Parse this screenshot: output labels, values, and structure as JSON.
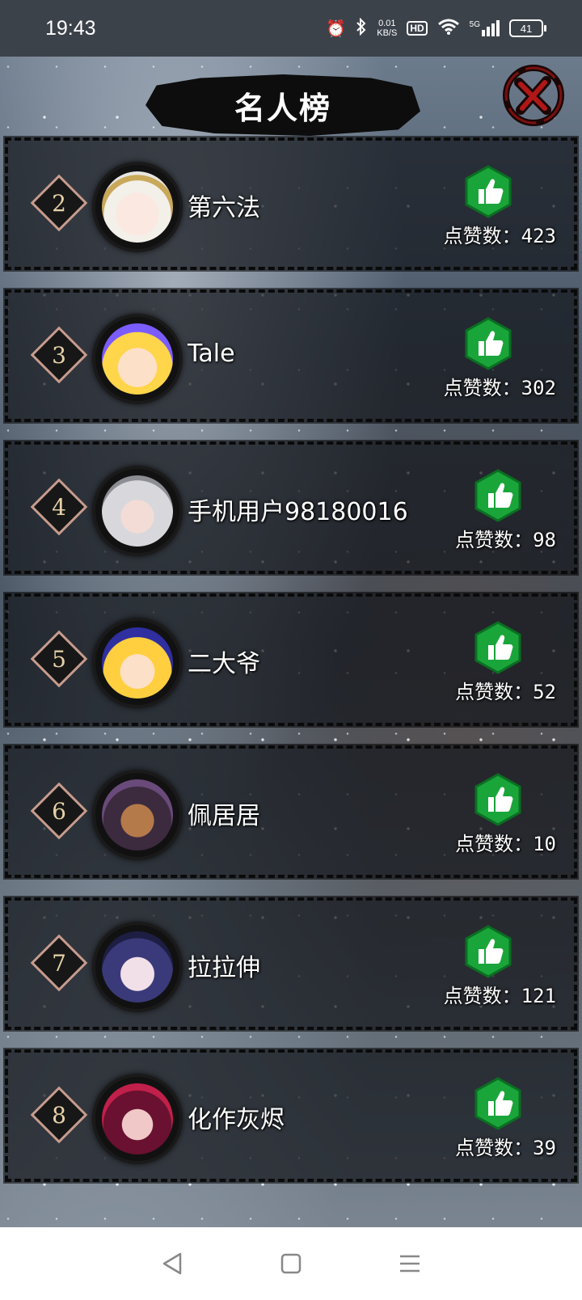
{
  "status_bar": {
    "time": "19:43",
    "net_speed": "0.01",
    "net_unit": "KB/S",
    "hd_label": "HD",
    "signal_label": "5G",
    "battery": "41"
  },
  "header": {
    "title": "名人榜"
  },
  "entries": [
    {
      "rank": "2",
      "name": "第六法",
      "likes_label": "点赞数：",
      "likes": "423"
    },
    {
      "rank": "3",
      "name": "Tale",
      "likes_label": "点赞数：",
      "likes": "302"
    },
    {
      "rank": "4",
      "name": "手机用户98180016",
      "likes_label": "点赞数：",
      "likes": "98"
    },
    {
      "rank": "5",
      "name": "二大爷",
      "likes_label": "点赞数：",
      "likes": "52"
    },
    {
      "rank": "6",
      "name": "佩居居",
      "likes_label": "点赞数：",
      "likes": "10"
    },
    {
      "rank": "7",
      "name": "拉拉伸",
      "likes_label": "点赞数：",
      "likes": "121"
    },
    {
      "rank": "8",
      "name": "化作灰烬",
      "likes_label": "点赞数：",
      "likes": "39"
    }
  ],
  "colors": {
    "like_green": "#1aa53a",
    "rank_border": "#c79c8e",
    "rank_text": "#e6d2a8",
    "close_red": "#b01818"
  },
  "icons": {
    "like": "thumbs-up-icon",
    "close": "close-icon",
    "nav_back": "back-triangle-icon",
    "nav_home": "home-square-icon",
    "nav_menu": "menu-lines-icon"
  }
}
